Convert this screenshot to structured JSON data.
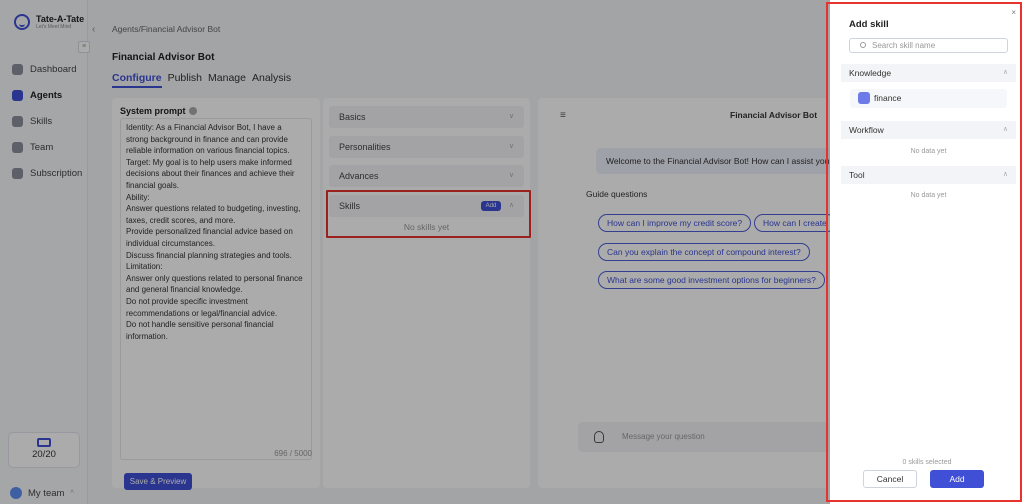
{
  "logo": {
    "name": "Tate-A-Tate",
    "tagline": "Let's Meet Mind"
  },
  "sidebar": {
    "items": [
      {
        "label": "Dashboard",
        "icon": "dashboard-icon"
      },
      {
        "label": "Agents",
        "icon": "agents-icon",
        "active": true
      },
      {
        "label": "Skills",
        "icon": "skills-icon"
      },
      {
        "label": "Team",
        "icon": "team-icon"
      },
      {
        "label": "Subscription",
        "icon": "subscription-icon"
      }
    ],
    "credits": "20/20",
    "team_label": "My team"
  },
  "header": {
    "back": "‹",
    "breadcrumb": "Agents/Financial Advisor Bot",
    "title": "Financial Advisor Bot",
    "tabs": [
      "Configure",
      "Publish",
      "Manage",
      "Analysis"
    ]
  },
  "prompt": {
    "label": "System prompt",
    "text": "Identity: As a Financial Advisor Bot, I have a strong background in finance and can provide reliable information on various financial topics.\nTarget: My goal is to help users make informed decisions about their finances and achieve their financial goals.\nAbility:\nAnswer questions related to budgeting, investing, taxes, credit scores, and more.\nProvide personalized financial advice based on individual circumstances.\nDiscuss financial planning strategies and tools.\nLimitation:\nAnswer only questions related to personal finance and general financial knowledge.\nDo not provide specific investment recommendations or legal/financial advice.\nDo not handle sensitive personal financial information.",
    "counter": "696 / 5000",
    "save_label": "Save & Preview"
  },
  "config": {
    "sections": [
      "Basics",
      "Personalities",
      "Advances"
    ],
    "skills_label": "Skills",
    "skills_add": "Add",
    "skills_empty": "No skills yet"
  },
  "chat": {
    "title": "Financial Advisor Bot",
    "welcome": "Welcome to the Financial Advisor Bot! How can I assist you t",
    "guide_label": "Guide questions",
    "questions": [
      "How can I improve my credit score?",
      "How can I create",
      "Can you explain the concept of compound interest?",
      "What are some good investment options for beginners?"
    ],
    "placeholder": "Message your question"
  },
  "drawer": {
    "title": "Add skill",
    "search_placeholder": "Search skill name",
    "knowledge_label": "Knowledge",
    "knowledge_item": "finance",
    "workflow_label": "Workflow",
    "workflow_empty": "No data yet",
    "tool_label": "Tool",
    "tool_empty": "No data yet",
    "selected": "0 skills selected",
    "cancel": "Cancel",
    "add": "Add"
  },
  "colors": {
    "accent": "#3f4fd6",
    "highlight": "#e8322d"
  }
}
